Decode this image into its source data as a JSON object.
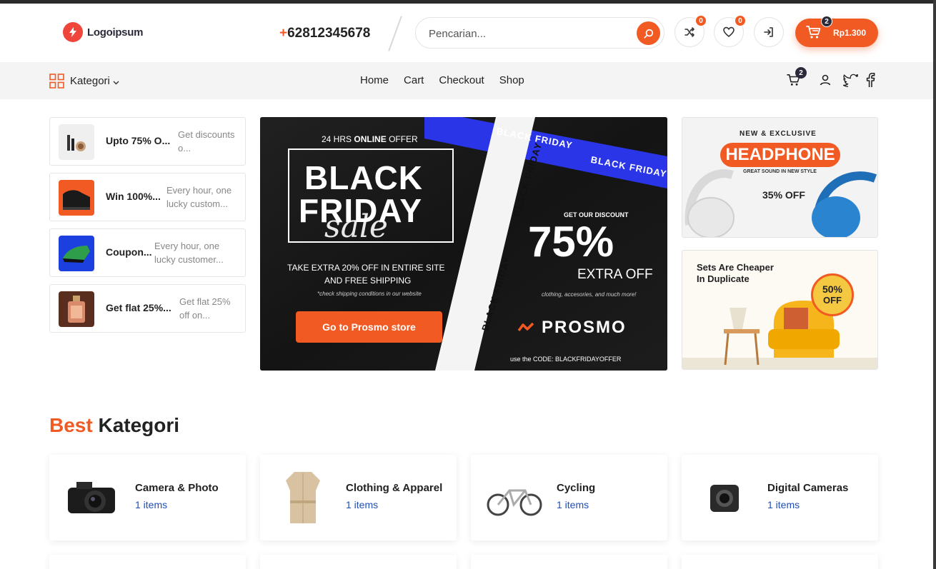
{
  "header": {
    "logo_text": "Logoipsum",
    "phone_plus": "+",
    "phone_number": "62812345678",
    "search_placeholder": "Pencarian...",
    "compare_count": "0",
    "wishlist_count": "0",
    "cart_count": "2",
    "cart_total": "Rp1.300"
  },
  "nav": {
    "kategori_label": "Kategori",
    "links": [
      "Home",
      "Cart",
      "Checkout",
      "Shop"
    ],
    "cart_count": "2"
  },
  "promos": [
    {
      "title": "Upto 75% O...",
      "desc": "Get discounts o..."
    },
    {
      "title": "Win 100%...",
      "desc": "Every hour, one lucky custom..."
    },
    {
      "title": "Coupon...",
      "desc": "Every hour, one lucky customer..."
    },
    {
      "title": "Get flat 25%...",
      "desc": "Get flat 25% off on..."
    }
  ],
  "hero": {
    "ribbon_text": "BLACK FRIDAY",
    "offer_prefix": "24 HRS",
    "offer_bold": "ONLINE",
    "offer_suffix": "OFFER",
    "black": "BLACK",
    "friday": "FRIDAY",
    "sale": "sale",
    "take_line1": "TAKE EXTRA 20% OFF IN ENTIRE SITE",
    "take_line2": "AND FREE SHIPPING",
    "check_note": "*check shipping conditions in our website",
    "cta": "Go to Prosmo store",
    "get_our": "GET OUR DISCOUNT",
    "percent": "75%",
    "extra_off": "EXTRA OFF",
    "clothing": "clothing, accesories, and much more!",
    "brand": "PROSMO",
    "code": "use the CODE: BLACKFRIDAYOFFER"
  },
  "banner_headphone": {
    "top": "NEW & EXCLUSIVE",
    "title": "HEADPHONE",
    "sub": "GREAT SOUND IN NEW STYLE",
    "discount": "35% OFF"
  },
  "banner_sets": {
    "line1": "Sets Are Cheaper",
    "line2": "In Duplicate",
    "badge_top": "50%",
    "badge_bottom": "OFF"
  },
  "best": {
    "accent": "Best",
    "title": "Kategori"
  },
  "categories": [
    {
      "name": "Camera & Photo",
      "count": "1 items"
    },
    {
      "name": "Clothing & Apparel",
      "count": "1 items"
    },
    {
      "name": "Cycling",
      "count": "1 items"
    },
    {
      "name": "Digital Cameras",
      "count": "1 items"
    }
  ],
  "colors": {
    "accent": "#f15a22",
    "dark": "#2a2a3a",
    "link_blue": "#1f4fb5",
    "hero_bg": "#141414",
    "ribbon_blue": "#2a35e8"
  }
}
